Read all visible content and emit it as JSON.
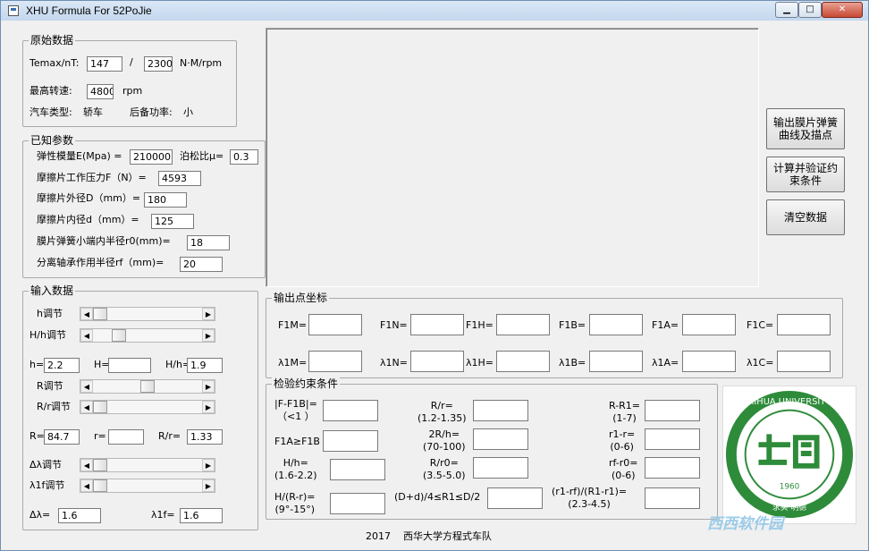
{
  "window": {
    "title": "XHU Formula  For 52PoJie",
    "min_glyph": "▁",
    "max_glyph": "□",
    "close_glyph": "✕"
  },
  "original": {
    "title": "原始数据",
    "temax_label": "Temax/nT:",
    "temax_value": "147",
    "separator": "/",
    "nt_value": "2300",
    "unit_nm": "N·M/rpm",
    "max_speed_label": "最高转速:",
    "max_speed_value": "4800",
    "rpm": "rpm",
    "car_type_label": "汽车类型:",
    "car_type_value": "轿车",
    "reserve_label": "后备功率:",
    "reserve_value": "小"
  },
  "known": {
    "title": "已知参数",
    "e_label": "弹性模量E(Mpa) =",
    "e_value": "210000",
    "mu_label": "泊松比μ=",
    "mu_value": "0.3",
    "f_label": "摩擦片工作压力F（N）=",
    "f_value": "4593",
    "d_out_label": "摩擦片外径D（mm）=",
    "d_out_value": "180",
    "d_in_label": "摩擦片内径d（mm）=",
    "d_in_value": "125",
    "r0_label": "膜片弹簧小端内半径r0(mm)=",
    "r0_value": "18",
    "rf_label": "分离轴承作用半径rf（mm)=",
    "rf_value": "20"
  },
  "input": {
    "title": "输入数据",
    "h_adj": "h调节",
    "Hh_adj": "H/h调节",
    "h_label": "h=",
    "h_value": "2.2",
    "H_label": "H=",
    "H_value": "",
    "Hh_label": "H/h=",
    "Hh_value": "1.9",
    "R_adj": "R调节",
    "Rr_adj": "R/r调节",
    "R_label": "R=",
    "R_value": "84.7",
    "r_label": "r=",
    "r_value": "",
    "Rr_label": "R/r=",
    "Rr_value": "1.33",
    "dl_adj": "Δλ调节",
    "l1f_adj": "λ1f调节",
    "dl_label": "Δλ=",
    "dl_value": "1.6",
    "l1f_label": "λ1f=",
    "l1f_value": "1.6",
    "sliders": {
      "h": 0.0,
      "Hh": 0.2,
      "R": 0.5,
      "Rr": 0.0,
      "dl": 0.0,
      "l1f": 0.0
    }
  },
  "buttons": {
    "output": "输出膜片弹簧曲线及描点",
    "calc": "计算并验证约束条件",
    "clear": "清空数据"
  },
  "points": {
    "title": "输出点坐标",
    "labels": [
      "F1M=",
      "F1N=",
      "F1H=",
      "F1B=",
      "F1A=",
      "F1C="
    ],
    "lambda_labels": [
      "λ1M=",
      "λ1N=",
      "λ1H=",
      "λ1B=",
      "λ1A=",
      "λ1C="
    ]
  },
  "checks": {
    "title": "检验约束条件",
    "c1": "|F-F1B|=\n（<1 ）",
    "c2": "F1A≥F1B",
    "c3": "H/h=\n(1.6-2.2)",
    "c4": "H/(R-r)=\n(9°-15°)",
    "c5": "R/r=\n(1.2-1.35)",
    "c6": "2R/h=\n(70-100)",
    "c7": "R/r0=\n(3.5-5.0)",
    "c8": "(D+d)/4≤R1≤D/2",
    "c9": "R-R1=\n(1-7)",
    "c10": "r1-r=\n(0-6)",
    "c11": "rf-r0=\n(0-6)",
    "c12": "(r1-rf)/(R1-r1)=\n(2.3-4.5)"
  },
  "footer": {
    "year": "2017",
    "team": "西华大学方程式车队"
  },
  "logo": {
    "text": "XIHUA UNIVERSITY",
    "year": "1960",
    "motto": "求实 明德"
  },
  "watermark": "西西软件园",
  "colors": {
    "logo_green": "#2e8b3a"
  }
}
